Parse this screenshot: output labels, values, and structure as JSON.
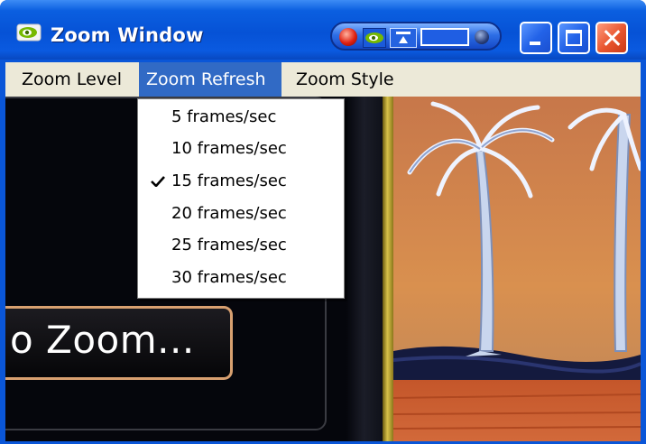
{
  "window": {
    "title": "Zoom Window",
    "app_icon": "nvidia-eye-icon",
    "titlebar_controls": [
      "record-icon",
      "nvidia-eye-icon",
      "stay-on-top-icon",
      "widescreen-icon",
      "dot-icon"
    ],
    "window_buttons": [
      "minimize-icon",
      "maximize-icon",
      "close-icon"
    ]
  },
  "menubar": {
    "items": [
      {
        "label": "Zoom Level"
      },
      {
        "label": "Zoom Refresh"
      },
      {
        "label": "Zoom Style"
      }
    ],
    "open_menu": "Zoom Refresh"
  },
  "dropdown": {
    "items": [
      {
        "label": "5 frames/sec",
        "checked": false
      },
      {
        "label": "10 frames/sec",
        "checked": false
      },
      {
        "label": "15 frames/sec",
        "checked": true
      },
      {
        "label": "20 frames/sec",
        "checked": false
      },
      {
        "label": "25 frames/sec",
        "checked": false
      },
      {
        "label": "30 frames/sec",
        "checked": false
      }
    ]
  },
  "content": {
    "zoom_button_label": "o Zoom..."
  },
  "colors": {
    "titlebar": "#0652d6",
    "menu_highlight": "#316ac5",
    "menubar_bg": "#ece9d8",
    "close_button": "#e8542d",
    "zoom_button_border": "#d8a070"
  }
}
